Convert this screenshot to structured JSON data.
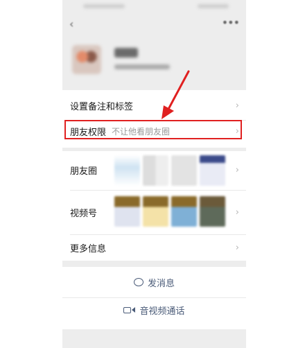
{
  "rows": {
    "remark": "设置备注和标签",
    "permission_label": "朋友权限",
    "permission_value": "不让他看朋友圈",
    "moments": "朋友圈",
    "channels": "视频号",
    "more_info": "更多信息"
  },
  "actions": {
    "message": "发消息",
    "video_call": "音视频通话"
  },
  "icons": {
    "back": "chevron-left-icon",
    "more": "more-horizontal-icon",
    "row_arrow": "chevron-right-icon",
    "message": "chat-bubble-icon",
    "video": "video-camera-icon"
  },
  "colors": {
    "highlight": "#e02020",
    "action_text": "#4a5b78",
    "background": "#ededed"
  }
}
